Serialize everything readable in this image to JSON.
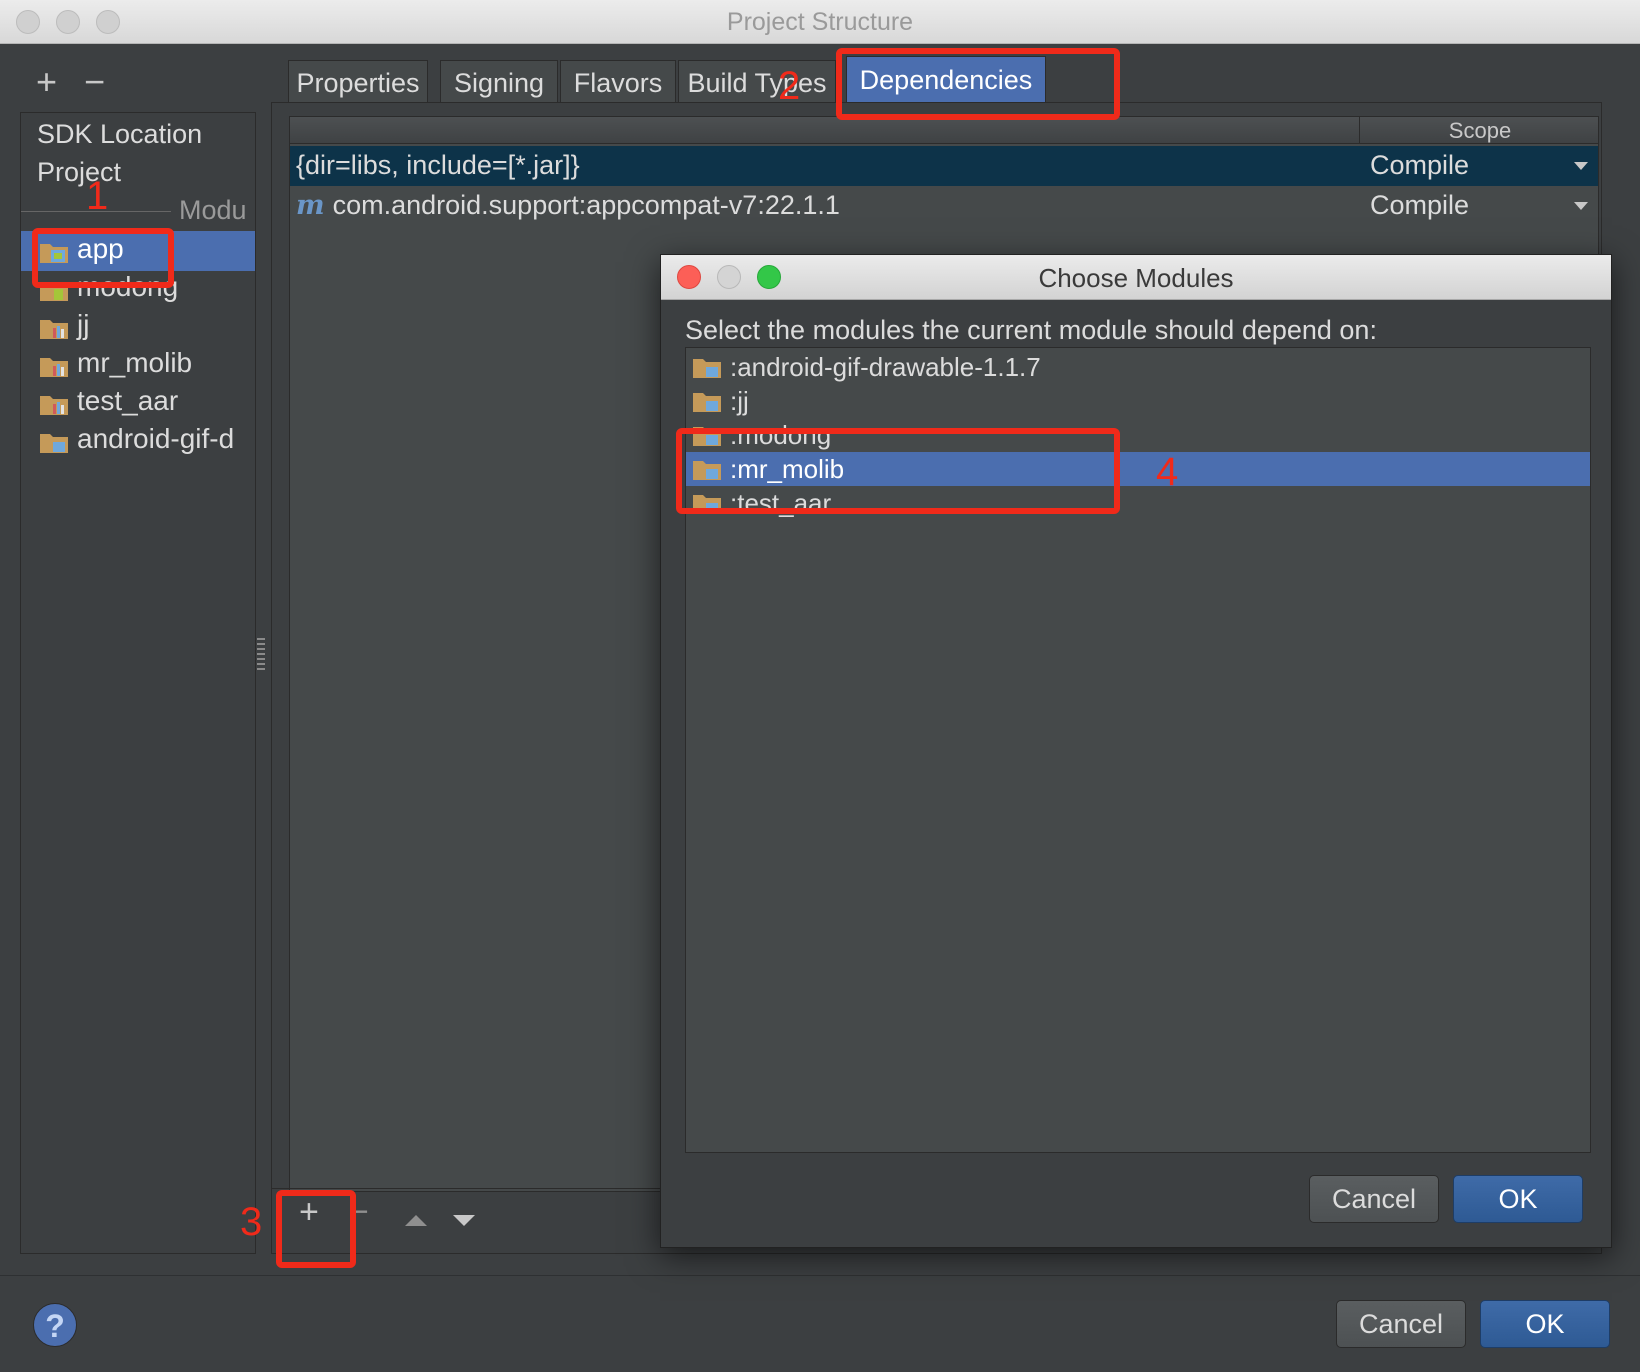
{
  "window": {
    "title": "Project Structure"
  },
  "left_pane": {
    "add_icon": "plus-icon",
    "remove_icon": "minus-icon",
    "sdk_location": "SDK Location",
    "project": "Project",
    "modules_header": "Modu",
    "modules": [
      {
        "label": "app",
        "icon": "android-app-folder-icon",
        "selected": true
      },
      {
        "label": "modong",
        "icon": "android-app-folder-icon"
      },
      {
        "label": "jj",
        "icon": "library-folder-icon"
      },
      {
        "label": "mr_molib",
        "icon": "library-folder-icon"
      },
      {
        "label": "test_aar",
        "icon": "library-folder-icon"
      },
      {
        "label": "android-gif-d",
        "icon": "module-folder-icon"
      }
    ]
  },
  "tabs": [
    {
      "label": "Properties"
    },
    {
      "label": "Signing"
    },
    {
      "label": "Flavors"
    },
    {
      "label": "Build Types"
    },
    {
      "label": "Dependencies",
      "active": true
    }
  ],
  "dependencies": {
    "scope_header": "Scope",
    "rows": [
      {
        "name": "{dir=libs, include=[*.jar]}",
        "scope": "Compile",
        "selected": true
      },
      {
        "name": "com.android.support:appcompat-v7:22.1.1",
        "scope": "Compile",
        "icon": "maven-icon",
        "icon_glyph": "m"
      }
    ],
    "toolbar": {
      "add": "+",
      "remove": "−",
      "move_up_icon": "move-up-icon",
      "move_down_icon": "move-down-icon"
    }
  },
  "dialog": {
    "title": "Choose Modules",
    "prompt": "Select the modules the current module should depend on:",
    "modules": [
      {
        "label": ":android-gif-drawable-1.1.7"
      },
      {
        "label": ":jj"
      },
      {
        "label": ":modong"
      },
      {
        "label": ":mr_molib",
        "selected": true
      },
      {
        "label": ":test_aar"
      }
    ],
    "cancel": "Cancel",
    "ok": "OK"
  },
  "footer": {
    "help": "?",
    "cancel": "Cancel",
    "ok": "OK"
  },
  "annotations": [
    "1",
    "2",
    "3",
    "4"
  ],
  "colors": {
    "selection_blue": "#4b6eaf",
    "row_selection_dark": "#0d3349",
    "annotation_red": "#f02a1a",
    "background": "#3c3f41"
  }
}
